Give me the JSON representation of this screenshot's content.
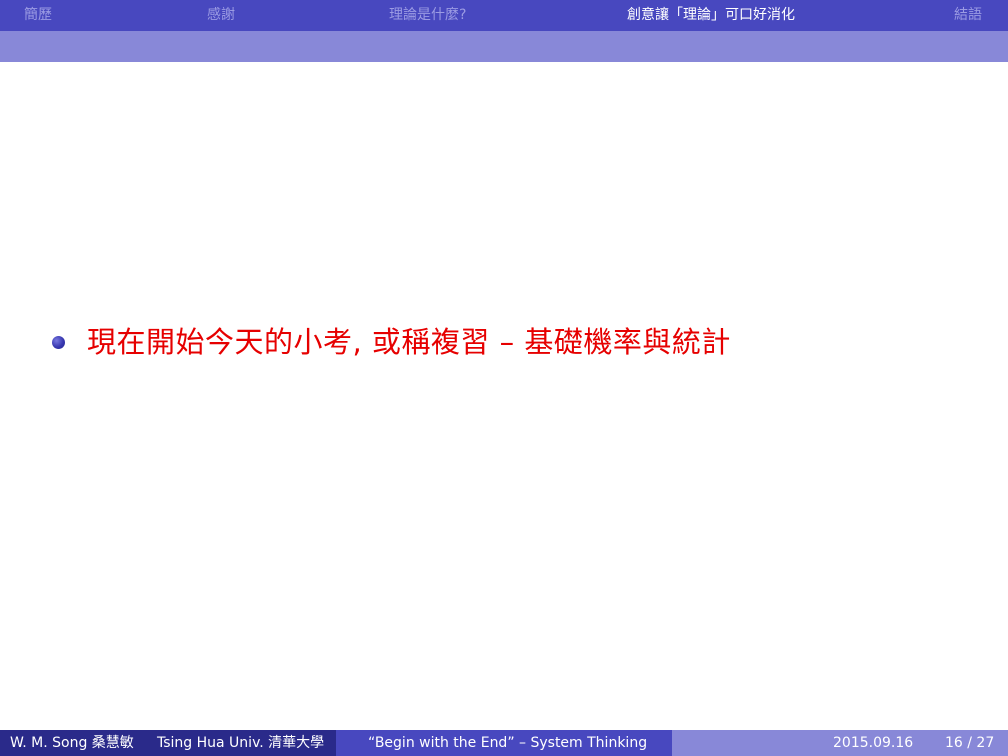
{
  "nav": {
    "items": [
      {
        "label": "簡歷",
        "active": false
      },
      {
        "label": "感謝",
        "active": false
      },
      {
        "label": "理論是什麼?",
        "active": false
      },
      {
        "label": "創意讓「理論」可口好消化",
        "active": true
      },
      {
        "label": "結語",
        "active": false
      }
    ]
  },
  "slide": {
    "bullets": [
      {
        "text": "現在開始今天的小考, 或稱複習 – 基礎機率與統計"
      }
    ]
  },
  "footer": {
    "author": "W. M. Song 桑慧敏",
    "institute": "Tsing Hua Univ. 清華大學",
    "title": "“Begin with the End” – System Thinking",
    "date": "2015.09.16",
    "page": "16 / 27"
  },
  "colors": {
    "nav_bar": "#4848bf",
    "sub_bar": "#8888d8",
    "bullet_text": "#e60000",
    "footer_left": "#2a2a8a",
    "footer_mid": "#4848bf",
    "footer_right": "#8888d8"
  }
}
